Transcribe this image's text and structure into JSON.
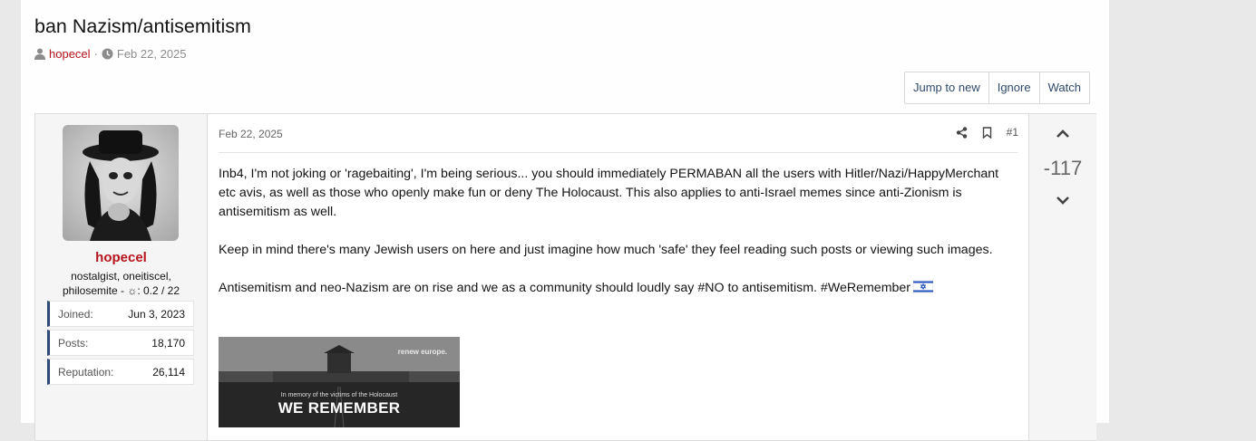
{
  "thread": {
    "title": "ban Nazism/antisemitism",
    "author": "hopecel",
    "separator": "·",
    "date": "Feb 22, 2025"
  },
  "actions": {
    "jump_to_new": "Jump to new",
    "ignore": "Ignore",
    "watch": "Watch"
  },
  "post": {
    "user": {
      "name": "hopecel",
      "title": "nostalgist, oneitiscel, philosemite - ☼: 0.2 / 22",
      "stats": [
        {
          "label": "Joined:",
          "value": "Jun 3, 2023"
        },
        {
          "label": "Posts:",
          "value": "18,170"
        },
        {
          "label": "Reputation:",
          "value": "26,114"
        }
      ]
    },
    "date": "Feb 22, 2025",
    "number": "#1",
    "paragraphs": [
      "Inb4, I'm not joking or 'ragebaiting', I'm being serious... you should immediately PERMABAN all the users with Hitler/Nazi/HappyMerchant etc avis, as well as those who openly make fun or deny The Holocaust. This also applies to anti-Israel memes since anti-Zionism is antisemitism as well.",
      "Keep in mind there's many Jewish users on here and just imagine how much 'safe' they feel reading such posts or viewing such images.",
      "Antisemitism and neo-Nazism are on rise and we as a community should loudly say #NO to antisemitism. #WeRemember"
    ],
    "embed": {
      "brand": "renew europe.",
      "memory": "In memory of the victims of the Holocaust",
      "headline": "WE REMEMBER"
    },
    "score": "-117"
  },
  "colors": {
    "username": "#b5141c",
    "stat_accent": "#2c4a73",
    "button_text": "#2e4a6b"
  }
}
